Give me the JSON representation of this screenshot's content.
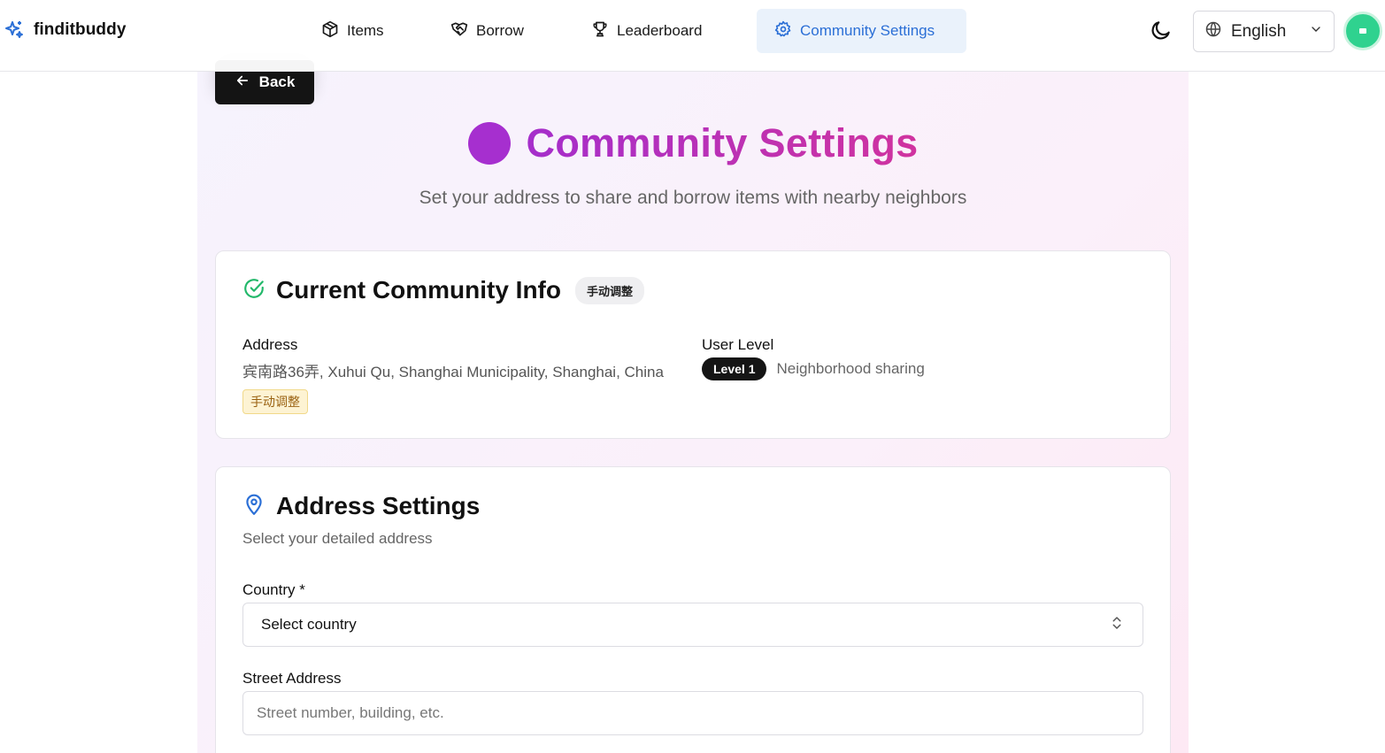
{
  "brand": {
    "name": "finditbuddy",
    "icon": "sparkles-icon"
  },
  "nav": {
    "items": [
      {
        "label": "Items",
        "icon": "package-icon"
      },
      {
        "label": "Borrow",
        "icon": "handshake-icon"
      },
      {
        "label": "Leaderboard",
        "icon": "trophy-icon"
      },
      {
        "label": "Community Settings",
        "icon": "gear-icon",
        "active": true
      }
    ]
  },
  "header_controls": {
    "theme_icon": "moon-icon",
    "language": "English",
    "language_icon": "globe-icon"
  },
  "back_button": {
    "label": "Back"
  },
  "page": {
    "title": "Community Settings",
    "subtitle": "Set your address to share and borrow items with nearby neighbors"
  },
  "community_info": {
    "title": "Current Community Info",
    "badge": "手动调整",
    "address_label": "Address",
    "address_value": "宾南路36弄, Xuhui Qu, Shanghai Municipality, Shanghai, China",
    "address_tag": "手动调整",
    "user_level_label": "User Level",
    "level_badge": "Level 1",
    "level_desc": "Neighborhood sharing"
  },
  "address_settings": {
    "title": "Address Settings",
    "description": "Select your detailed address",
    "country_label": "Country *",
    "country_value": "Select country",
    "street_label": "Street Address",
    "street_placeholder": "Street number, building, etc."
  },
  "colors": {
    "accent_blue": "#2b6fd6",
    "title_gradient_start": "#a52ecb",
    "title_gradient_end": "#d0339f",
    "success_green": "#22b86a",
    "avatar_green": "#2fd28f"
  }
}
